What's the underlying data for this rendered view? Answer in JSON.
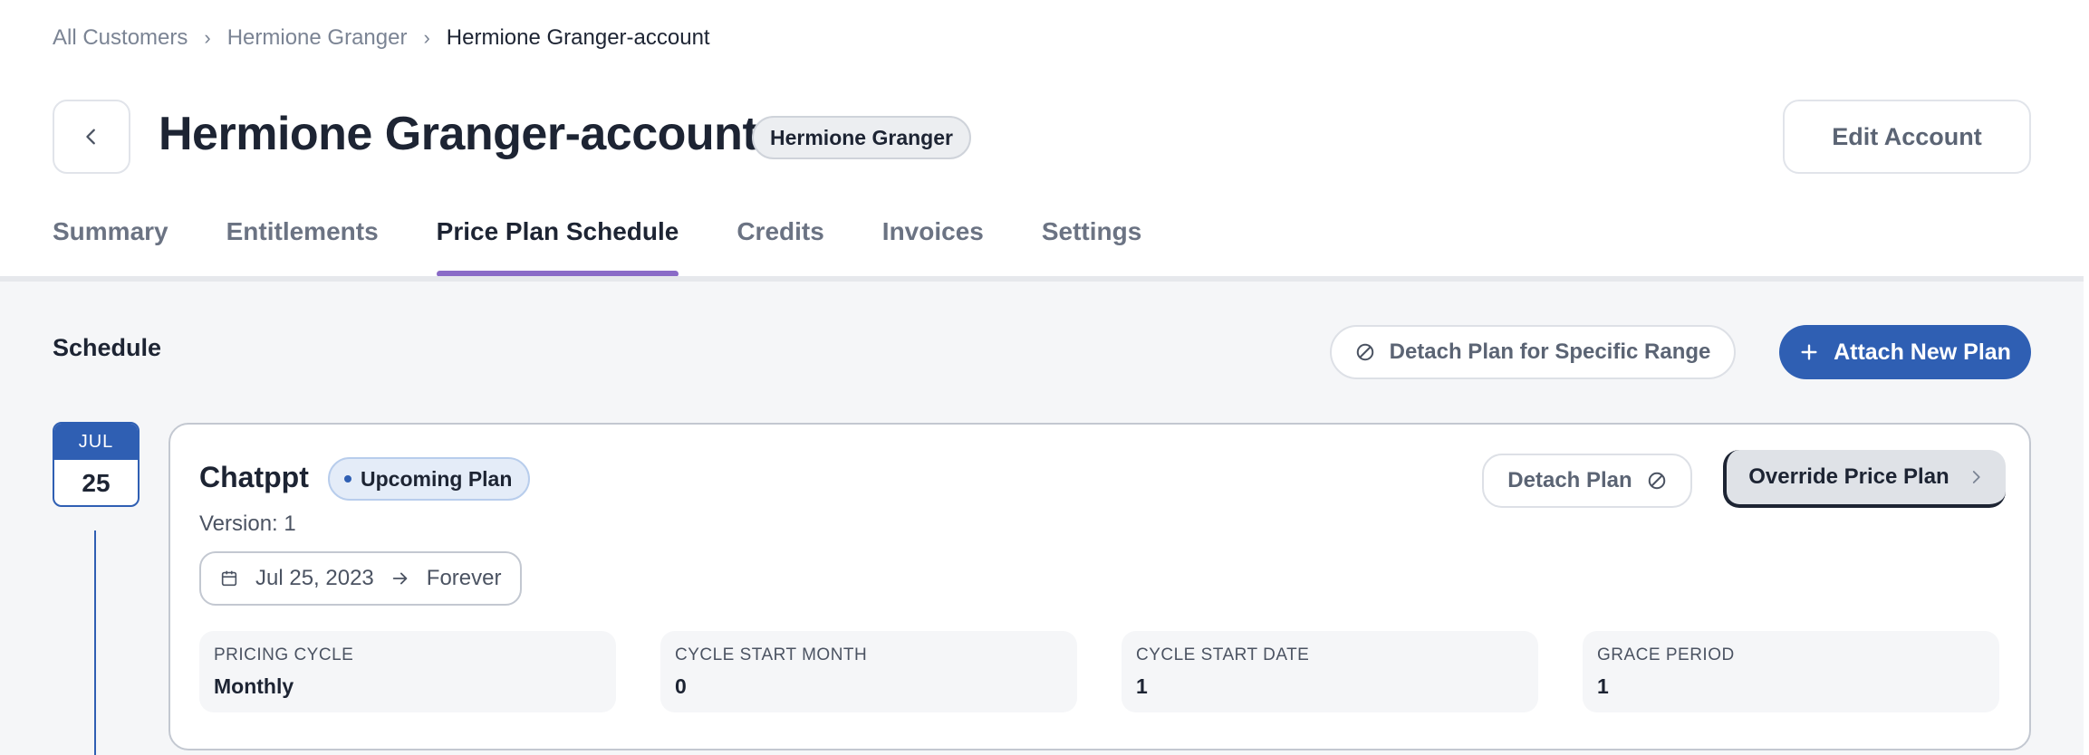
{
  "breadcrumb": {
    "items": [
      "All Customers",
      "Hermione Granger",
      "Hermione Granger-account"
    ],
    "separator": "›"
  },
  "header": {
    "title": "Hermione Granger-account",
    "customer_badge": "Hermione Granger",
    "edit_label": "Edit Account"
  },
  "tabs": [
    {
      "label": "Summary",
      "active": false
    },
    {
      "label": "Entitlements",
      "active": false
    },
    {
      "label": "Price Plan Schedule",
      "active": true
    },
    {
      "label": "Credits",
      "active": false
    },
    {
      "label": "Invoices",
      "active": false
    },
    {
      "label": "Settings",
      "active": false
    }
  ],
  "schedule": {
    "title": "Schedule",
    "detach_range_label": "Detach Plan for Specific Range",
    "attach_label": "Attach New Plan",
    "date_badge": {
      "month": "JUL",
      "day": "25"
    },
    "plan": {
      "name": "Chatppt",
      "status": "Upcoming Plan",
      "version": "Version: 1",
      "start_date": "Jul 25, 2023",
      "end_date": "Forever",
      "detach_label": "Detach Plan",
      "override_label": "Override Price Plan",
      "stats": [
        {
          "label": "PRICING CYCLE",
          "value": "Monthly"
        },
        {
          "label": "CYCLE START MONTH",
          "value": "0"
        },
        {
          "label": "CYCLE START DATE",
          "value": "1"
        },
        {
          "label": "GRACE PERIOD",
          "value": "1"
        }
      ]
    }
  },
  "colors": {
    "accent": "#2f5fb3",
    "tab_indicator": "#8a6bc7",
    "text_primary": "#1d2433",
    "text_muted": "#7b8494"
  },
  "icons": {
    "back": "chevron-left-icon",
    "detach": "ban-icon",
    "add": "plus-icon",
    "calendar": "calendar-icon",
    "arrow": "arrow-right-icon",
    "chevron": "chevron-right-icon"
  }
}
